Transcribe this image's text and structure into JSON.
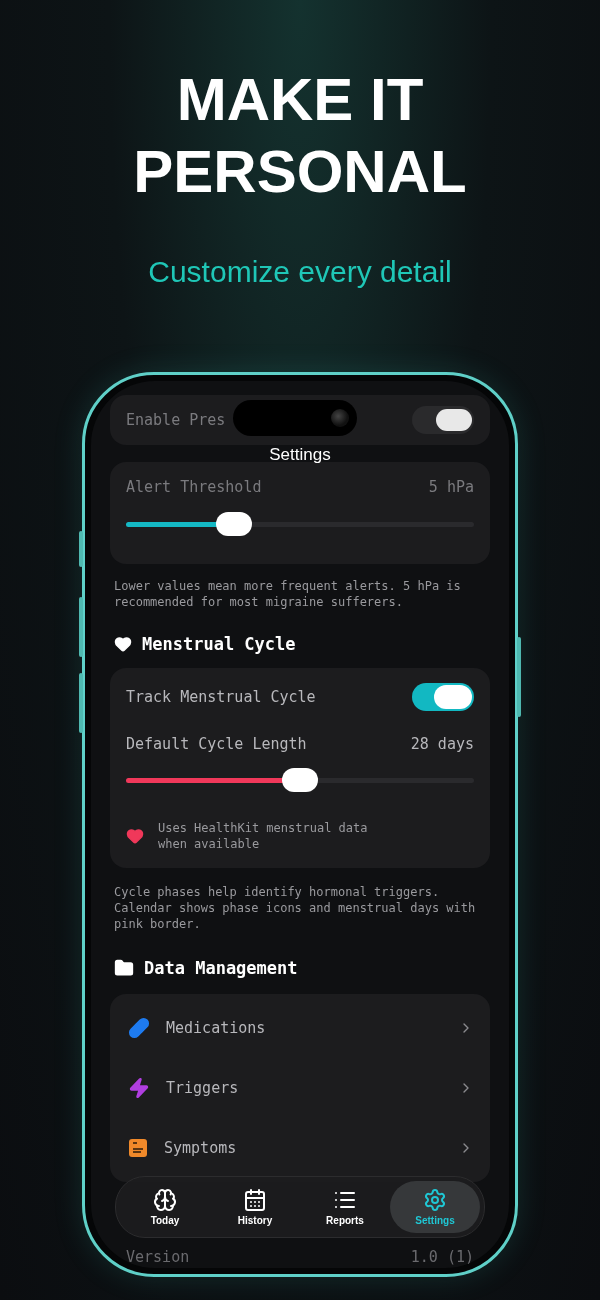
{
  "headline": [
    "MAKE IT",
    "PERSONAL"
  ],
  "subtitle": "Customize every detail",
  "screen": {
    "title": "Settings",
    "pressure": {
      "label": "Enable Pres",
      "on": true,
      "threshold_label": "Alert Threshold",
      "threshold_value": "5 hPa",
      "level": 0.31,
      "note": "Lower values mean more frequent alerts. 5 hPa is recommended for most migraine sufferers."
    },
    "menstrual": {
      "heading": "Menstrual Cycle",
      "track_label": "Track Menstrual Cycle",
      "track_on": true,
      "length_label": "Default Cycle Length",
      "length_value": "28 days",
      "level": 0.5,
      "info": "Uses HealthKit menstrual data when available",
      "note": "Cycle phases help identify hormonal triggers. Calendar shows phase icons and menstrual days with pink border."
    },
    "data_management": {
      "heading": "Data Management",
      "items": [
        {
          "label": "Medications",
          "kind": "pill"
        },
        {
          "label": "Triggers",
          "kind": "bolt"
        },
        {
          "label": "Symptoms",
          "kind": "card"
        }
      ]
    },
    "version": {
      "label": "Version",
      "value": "1.0 (1)"
    },
    "tabs": [
      {
        "label": "Today",
        "kind": "brain",
        "selected": false
      },
      {
        "label": "History",
        "kind": "calendar",
        "selected": false
      },
      {
        "label": "Reports",
        "kind": "list",
        "selected": false
      },
      {
        "label": "Settings",
        "kind": "gear",
        "selected": true
      }
    ]
  }
}
